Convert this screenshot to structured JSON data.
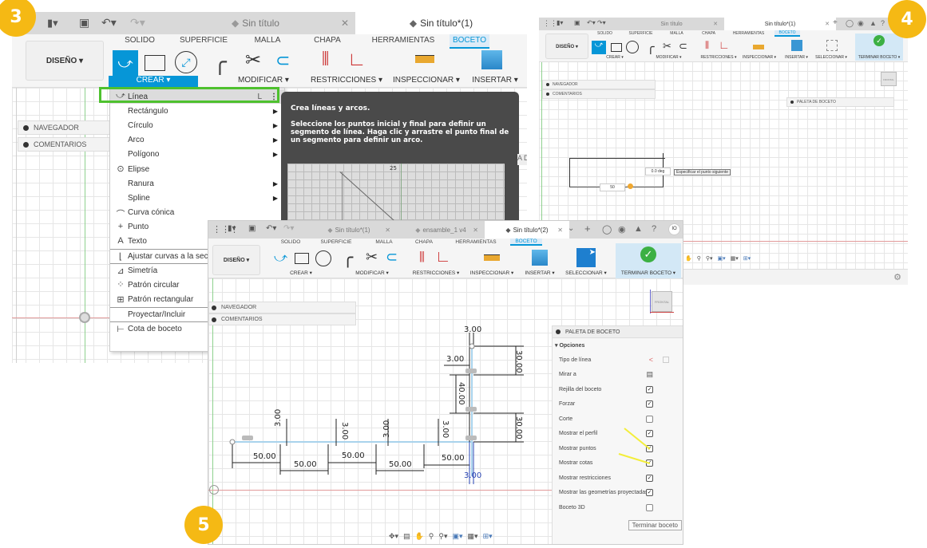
{
  "steps": {
    "step3": "3",
    "step4": "4",
    "step5": "5"
  },
  "shot3": {
    "tabs": [
      {
        "label": "Sin título",
        "active": false
      },
      {
        "label": "Sin título*(1)",
        "active": true
      }
    ],
    "ribbon_tabs": [
      "SOLIDO",
      "SUPERFICIE",
      "MALLA",
      "CHAPA",
      "HERRAMIENTAS",
      "BOCETO"
    ],
    "active_ribbon_tab": "BOCETO",
    "workspace": "DISEÑO ▾",
    "groups": [
      "CREAR ▾",
      "MODIFICAR ▾",
      "RESTRICCIONES ▾",
      "INSPECCIONAR ▾",
      "INSERTAR ▾"
    ],
    "panels": [
      "NAVEGADOR",
      "COMENTARIOS"
    ],
    "menu": [
      {
        "label": "Línea",
        "shortcut": "L",
        "icon": "line-icon",
        "glyph": "⤻",
        "submenu": false,
        "highlighted": true
      },
      {
        "label": "Rectángulo",
        "icon": "",
        "glyph": "",
        "submenu": true
      },
      {
        "label": "Círculo",
        "icon": "",
        "glyph": "",
        "submenu": true
      },
      {
        "label": "Arco",
        "icon": "",
        "glyph": "",
        "submenu": true
      },
      {
        "label": "Polígono",
        "icon": "",
        "glyph": "",
        "submenu": true
      },
      {
        "label": "Elipse",
        "icon": "ellipse-icon",
        "glyph": "⊙",
        "submenu": false
      },
      {
        "label": "Ranura",
        "icon": "",
        "glyph": "",
        "submenu": true
      },
      {
        "label": "Spline",
        "icon": "",
        "glyph": "",
        "submenu": true
      },
      {
        "label": "Curva cónica",
        "icon": "conic-curve-icon",
        "glyph": "⌒",
        "submenu": false
      },
      {
        "label": "Punto",
        "icon": "point-icon",
        "glyph": "+",
        "submenu": false
      },
      {
        "label": "Texto",
        "icon": "text-icon",
        "glyph": "A",
        "submenu": false
      },
      {
        "label": "Ajustar curvas a la secc",
        "icon": "fit-curves-icon",
        "glyph": "⌊",
        "submenu": false,
        "separator": true
      },
      {
        "label": "Simetría",
        "icon": "mirror-icon",
        "glyph": "⊿",
        "submenu": false,
        "separator": true
      },
      {
        "label": "Patrón circular",
        "icon": "circular-pattern-icon",
        "glyph": "⁘",
        "submenu": false
      },
      {
        "label": "Patrón rectangular",
        "icon": "rectangular-pattern-icon",
        "glyph": "⊞",
        "submenu": false
      },
      {
        "label": "Proyectar/Incluir",
        "icon": "",
        "glyph": "",
        "submenu": false,
        "separator": true
      },
      {
        "label": "Cota de boceto",
        "icon": "sketch-dimension-icon",
        "glyph": "⊢",
        "submenu": false,
        "separator": true
      }
    ],
    "tooltip": {
      "title": "Crea líneas y arcos.",
      "body": "Seleccione los puntos inicial y final para definir un segmento de línea. Haga clic y arrastre el punto final de un segmento para definir un arco.",
      "preview_label": "25"
    },
    "partial_label": "A DI"
  },
  "shot4": {
    "tabs": [
      {
        "label": "Sin título",
        "active": false
      },
      {
        "label": "Sin título*(1)",
        "active": true
      }
    ],
    "ribbon_tabs": [
      "SOLIDO",
      "SUPERFICIE",
      "MALLA",
      "CHAPA",
      "HERRAMIENTAS",
      "BOCETO"
    ],
    "workspace": "DISEÑO ▾",
    "groups": [
      "CREAR ▾",
      "MODIFICAR ▾",
      "RESTRICCIONES ▾",
      "INSPECCIONAR ▾",
      "INSERTAR ▾",
      "SELECCIONAR ▾",
      "TERMINAR BOCETO ▾"
    ],
    "panels": [
      "NAVEGADOR",
      "COMENTARIOS"
    ],
    "palette": "PALETA DE BOCETO",
    "angle_input": "0.0 deg",
    "length_input": "50",
    "prompt": "Especificar el punto siguiente",
    "viewcube": "FRONTAL"
  },
  "shot5": {
    "tabs": [
      {
        "label": "Sin título*(1)",
        "active": false
      },
      {
        "label": "ensamble_1 v4",
        "active": false
      },
      {
        "label": "Sin título*(2)",
        "active": true
      }
    ],
    "user_initials": "IO",
    "ribbon_tabs": [
      "SOLIDO",
      "SUPERFICIE",
      "MALLA",
      "CHAPA",
      "HERRAMIENTAS",
      "BOCETO"
    ],
    "workspace": "DISEÑO ▾",
    "groups": [
      "CREAR ▾",
      "MODIFICAR ▾",
      "RESTRICCIONES ▾",
      "INSPECCIONAR ▾",
      "INSERTAR ▾",
      "SELECCIONAR ▾",
      "TERMINAR BOCETO ▾"
    ],
    "panels": [
      "NAVEGADOR",
      "COMENTARIOS"
    ],
    "viewcube": "FRONTAL",
    "palette": {
      "title": "PALETA DE BOCETO",
      "section": "▾ Opciones",
      "options": [
        {
          "label": "Tipo de línea",
          "type": "icons"
        },
        {
          "label": "Mirar a",
          "type": "icon"
        },
        {
          "label": "Rejilla del boceto",
          "checked": true
        },
        {
          "label": "Forzar",
          "checked": true
        },
        {
          "label": "Corte",
          "checked": false
        },
        {
          "label": "Mostrar el perfil",
          "checked": true
        },
        {
          "label": "Mostrar puntos",
          "checked": true
        },
        {
          "label": "Mostrar cotas",
          "checked": true
        },
        {
          "label": "Mostrar restricciones",
          "checked": true
        },
        {
          "label": "Mostrar las geometrías proyectadas",
          "checked": true
        },
        {
          "label": "Boceto 3D",
          "checked": false
        }
      ],
      "finish_button": "Terminar boceto"
    },
    "dimensions": {
      "horizontal": [
        "50.00",
        "50.00",
        "50.00",
        "50.00",
        "50.00"
      ],
      "small_vertical": [
        "3.00",
        "3.00",
        "3.00",
        "3.00"
      ],
      "top_width": "3.00",
      "mid_width": "3.00",
      "bottom_width": "3.00",
      "right_upper": "30.00",
      "right_lower": "30.00",
      "left_mid": "40.00"
    }
  }
}
